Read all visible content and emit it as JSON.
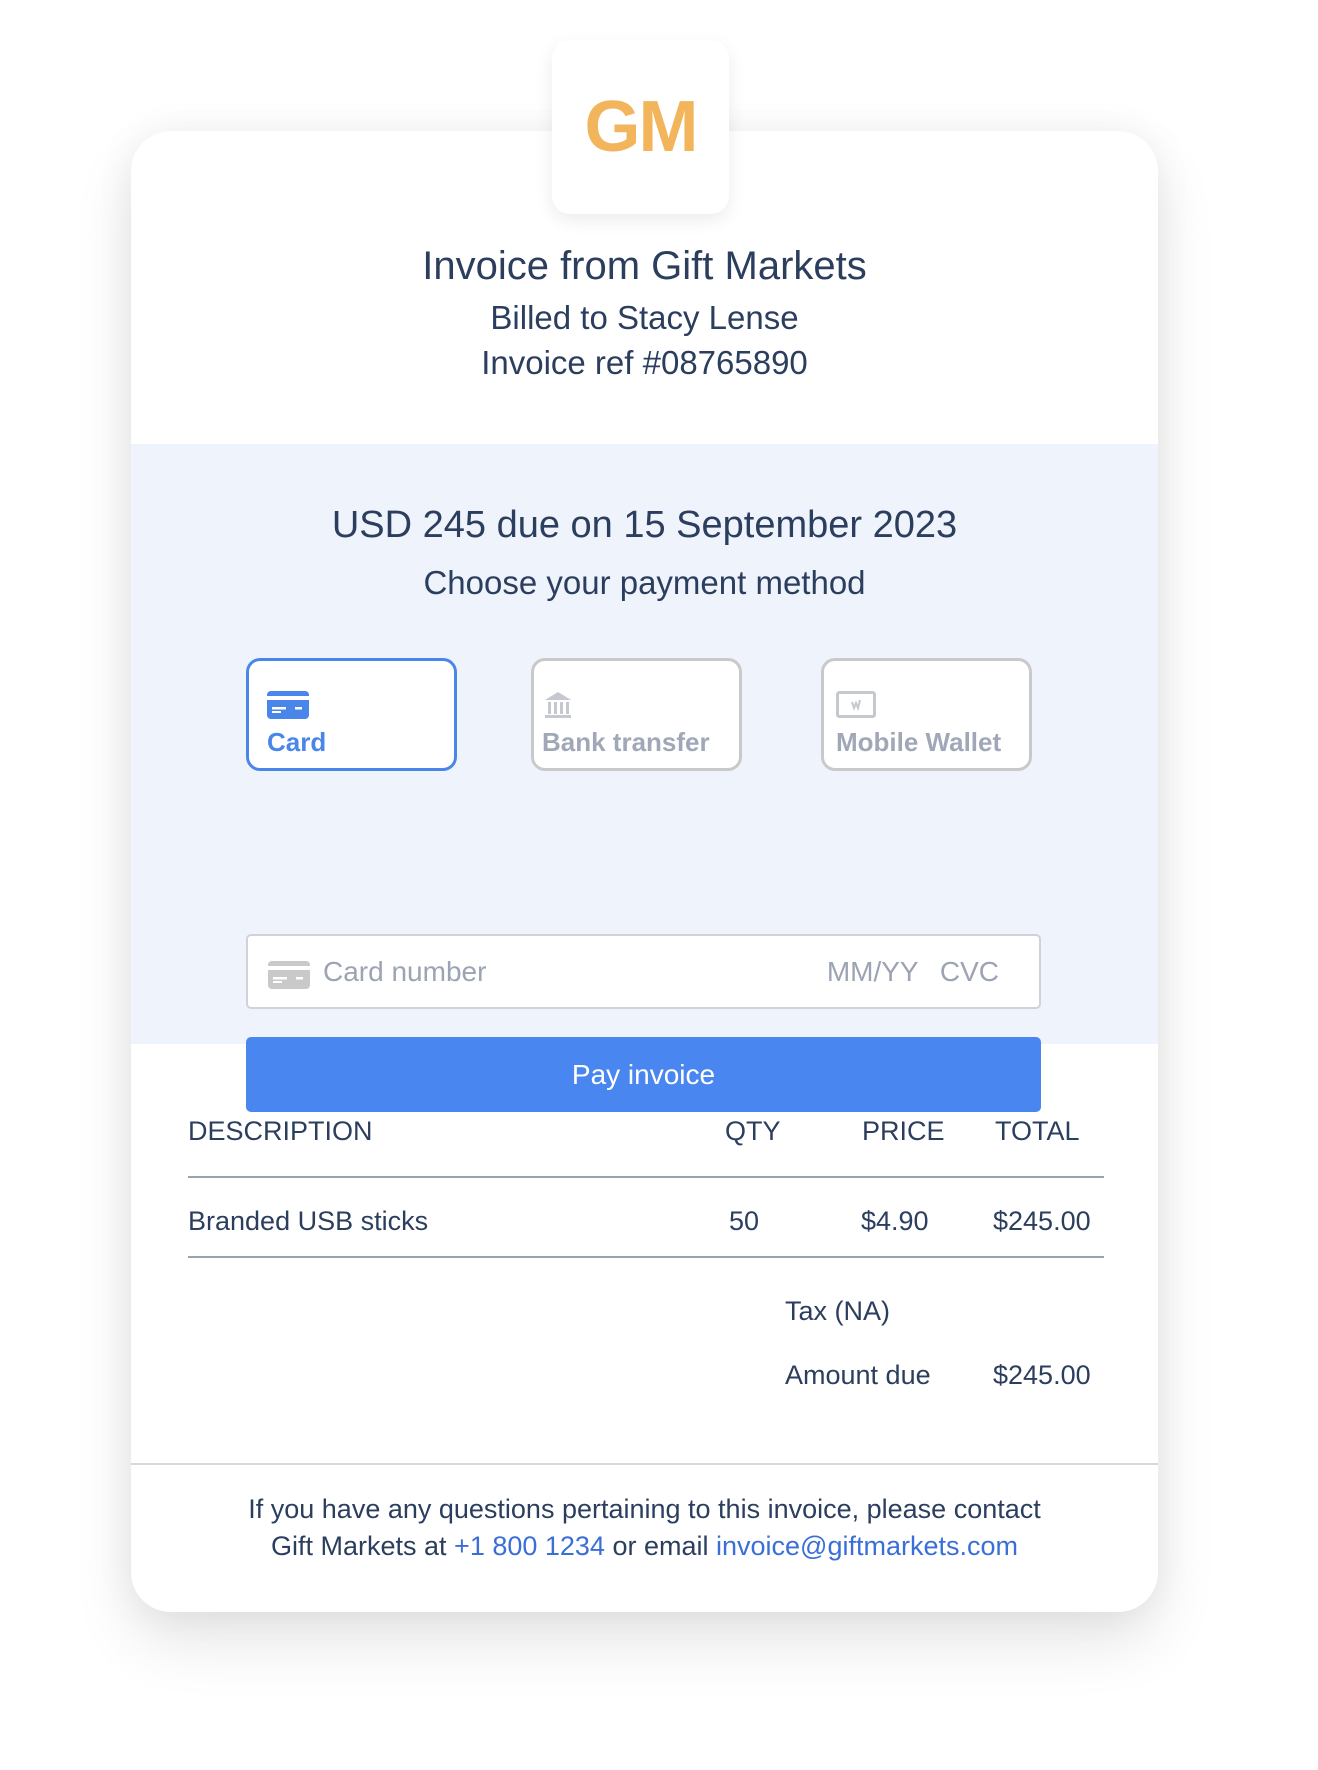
{
  "brand": {
    "logo_text": "GM",
    "logo_color": "#f2b55c",
    "accent_color": "#4a86f0"
  },
  "header": {
    "title": "Invoice from Gift Markets",
    "billed_to": "Billed to Stacy Lense",
    "invoice_ref": "Invoice ref #08765890"
  },
  "payment": {
    "due_text": "USD 245 due on 15 September 2023",
    "choose_text": "Choose your payment method",
    "methods": [
      {
        "label": "Card",
        "icon": "credit-card-icon",
        "selected": true
      },
      {
        "label": "Bank transfer",
        "icon": "bank-icon",
        "selected": false
      },
      {
        "label": "Mobile Wallet",
        "icon": "mobile-wallet-icon",
        "selected": false
      }
    ],
    "card_number_placeholder": "Card number",
    "expiry_placeholder": "MM/YY",
    "cvc_placeholder": "CVC",
    "pay_button_label": "Pay invoice"
  },
  "table": {
    "columns": [
      "DESCRIPTION",
      "QTY",
      "PRICE",
      "TOTAL"
    ],
    "rows": [
      {
        "description": "Branded USB sticks",
        "qty": "50",
        "price": "$4.90",
        "total": "$245.00"
      }
    ],
    "tax_label": "Tax (NA)",
    "tax_value": "",
    "amount_due_label": "Amount due",
    "amount_due_value": "$245.00"
  },
  "footer": {
    "line1": "If you have any questions pertaining to this invoice, please contact",
    "line2_prefix": "Gift Markets at ",
    "phone": "+1 800 1234",
    "line2_middle": " or email ",
    "email": "invoice@giftmarkets.com"
  }
}
